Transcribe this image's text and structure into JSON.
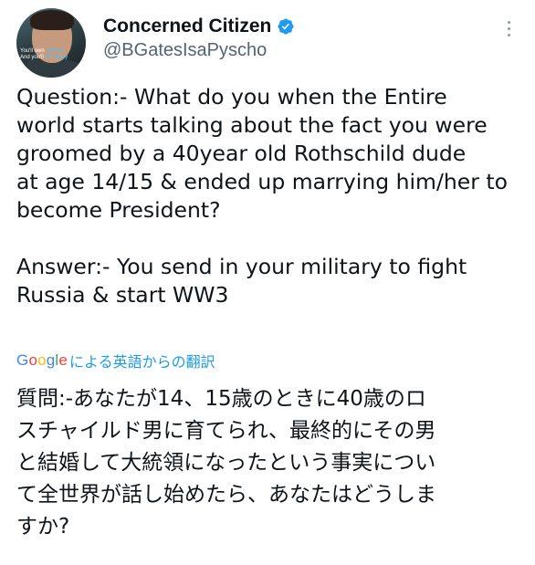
{
  "author": {
    "display_name": "Concerned Citizen",
    "handle": "@BGatesIsaPyscho",
    "verified_icon": "verified-badge-icon",
    "verified_color": "#1d9bf0",
    "avatar_text": {
      "line1_a": "You'll own ",
      "line1_b": "nothing",
      "line2_a": "And you'll ",
      "line2_b": "be happy"
    }
  },
  "menu": {
    "icon": "more-vertical-icon"
  },
  "tweet": {
    "text": "Question:- What do you when the Entire\nworld starts talking about the fact you were\ngroomed by a 40year old Rothschild dude\nat age 14/15 & ended up marrying him/her to\nbecome President?\n\nAnswer:- You send in your military to fight\nRussia & start WW3"
  },
  "translation": {
    "provider": "Google",
    "link_label": "による英語からの翻訳",
    "link_color": "#1d9bf0",
    "text": "質問:-あなたが14、15歳のときに40歳のロ\nスチャイルド男に育てられ、最終的にその男\nと結婚して大統領になったという事実につい\nて全世界が話し始めたら、あなたはどうしま\nすか?"
  }
}
